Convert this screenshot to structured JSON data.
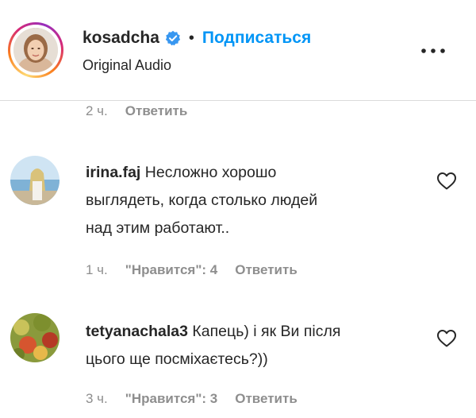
{
  "header": {
    "username": "kosadcha",
    "separator": "•",
    "follow_label": "Подписаться",
    "audio_label": "Original Audio",
    "verified_color": "#3897f0",
    "more_icon": "more-horizontal-icon"
  },
  "top_meta": {
    "time": "2 ч.",
    "reply_label": "Ответить"
  },
  "comments": [
    {
      "author": "irina.faj",
      "line1": "Несложно хорошо",
      "line2": "выглядеть, когда столько людей",
      "line3": "над этим работают..",
      "time": "1 ч.",
      "likes": "\"Нравится\": 4",
      "reply_label": "Ответить",
      "like_icon": "heart-icon"
    },
    {
      "author": "tetyanachala3",
      "line1": "Капець) і як Ви після",
      "line2": "цього ще посміхаєтесь?))",
      "time": "3 ч.",
      "likes": "\"Нравится\": 3",
      "reply_label": "Ответить",
      "like_icon": "heart-icon"
    }
  ],
  "colors": {
    "link_blue": "#0095f6",
    "muted_gray": "#8e8e8e",
    "divider": "#dbdbdb"
  }
}
